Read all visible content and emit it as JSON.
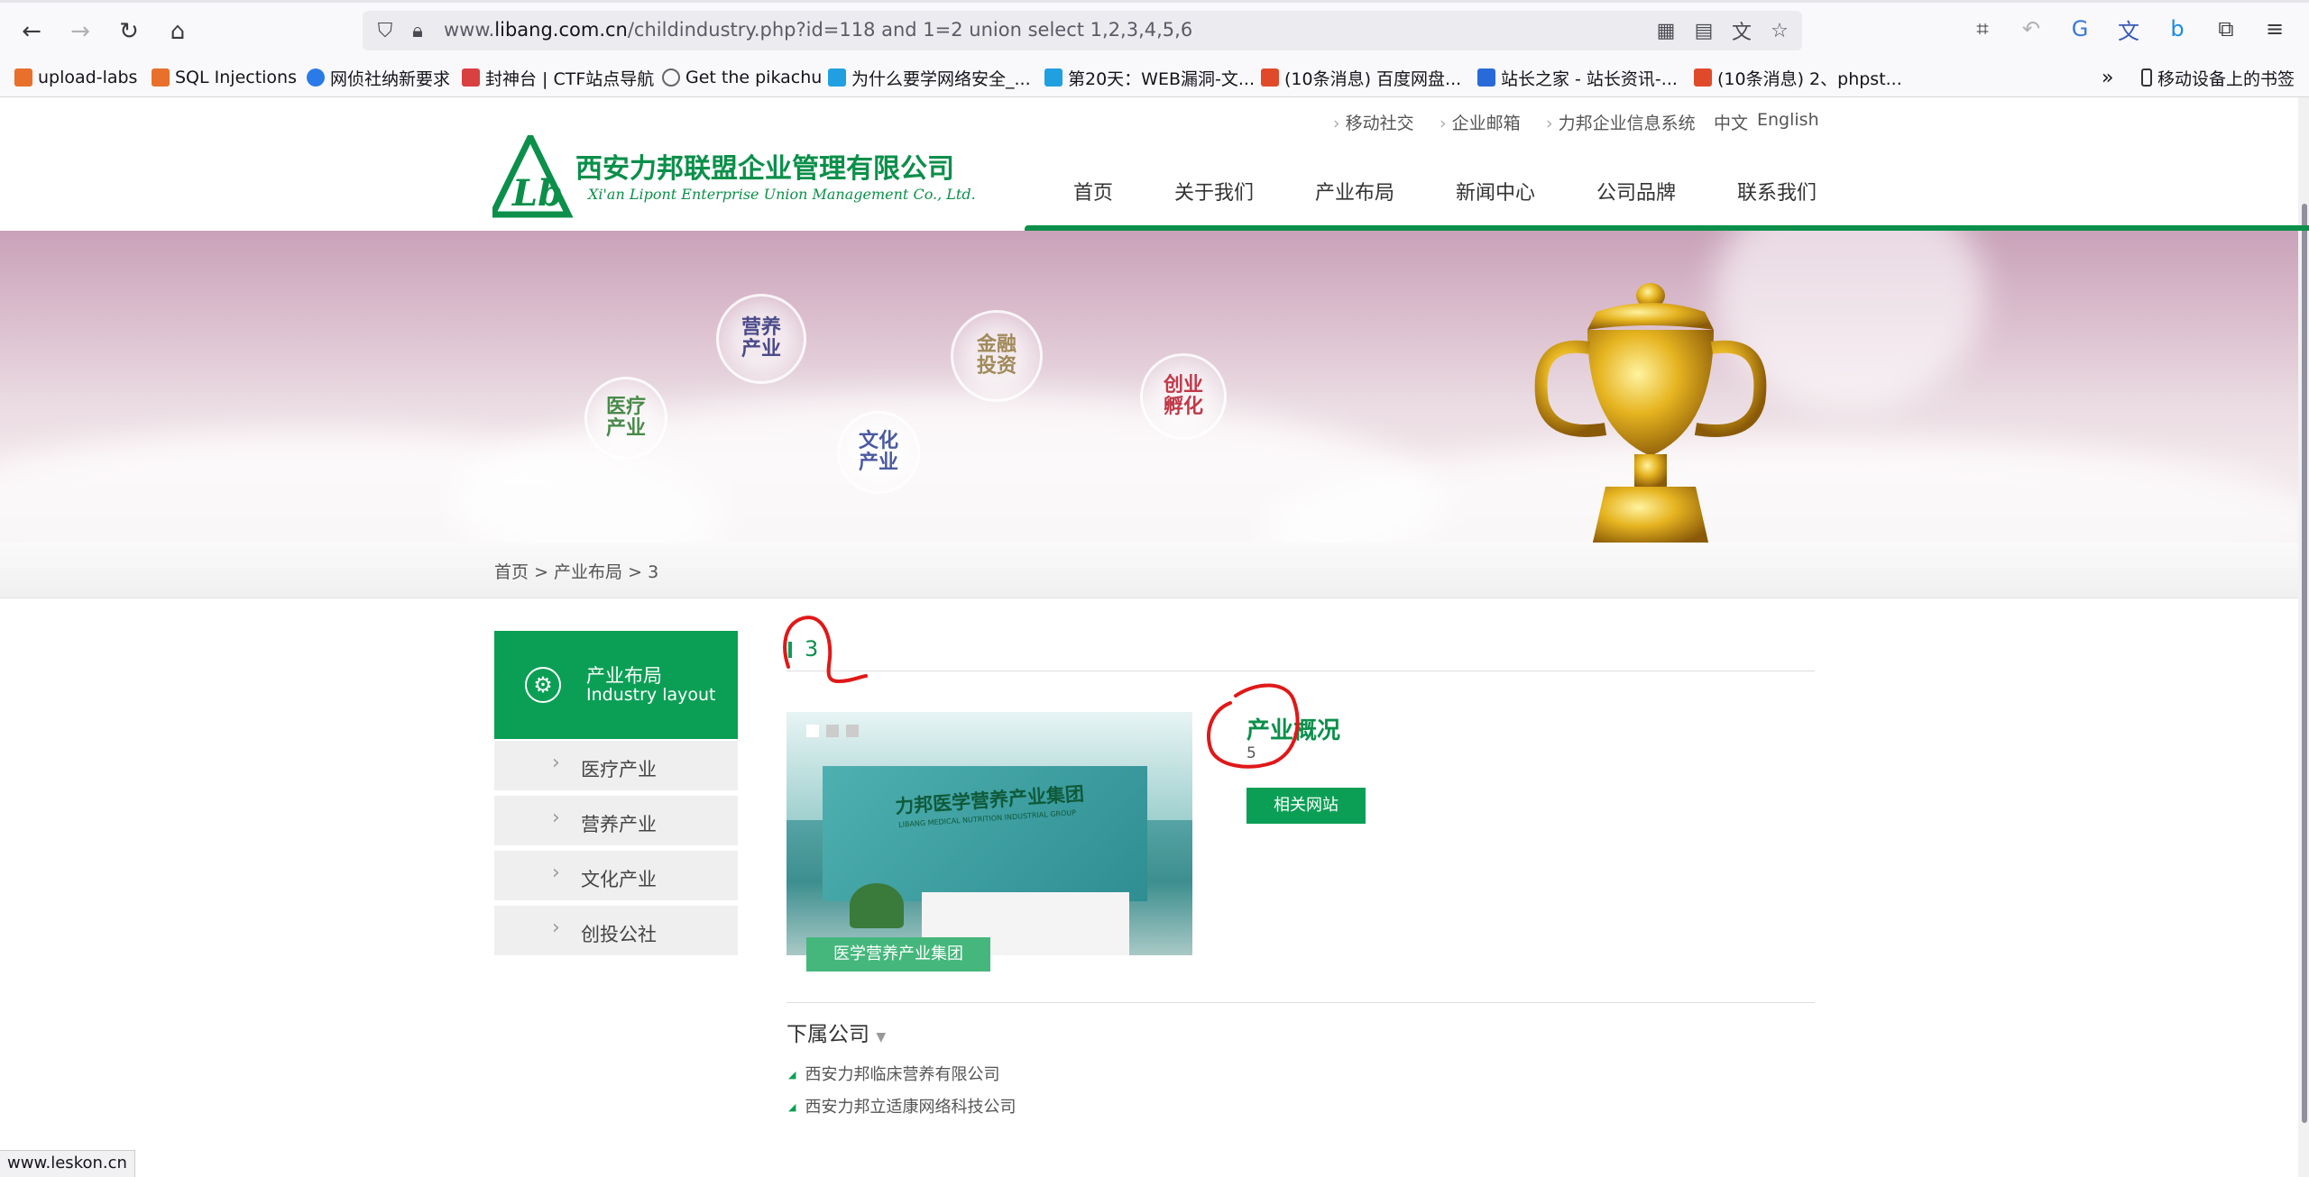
{
  "browser": {
    "url_prefix": "www.",
    "url_domain": "libang.com.cn",
    "url_path": "/childindustry.php?id=118 and 1=2 union select 1,2,3,4,5,6",
    "bookmarks": [
      {
        "label": "upload-labs",
        "color": "#e8702a"
      },
      {
        "label": "SQL Injections",
        "color": "#e8702a"
      },
      {
        "label": "网侦社纳新要求",
        "color": "#2a7be8"
      },
      {
        "label": "封神台 | CTF站点导航",
        "color": "#d94040"
      },
      {
        "label": "Get the pikachu",
        "color": "#666666"
      },
      {
        "label": "为什么要学网络安全_...",
        "color": "#20a0e0"
      },
      {
        "label": "第20天：WEB漏洞-文...",
        "color": "#20a0e0"
      },
      {
        "label": "(10条消息) 百度网盘...",
        "color": "#e04a2a"
      },
      {
        "label": "站长之家 - 站长资讯-...",
        "color": "#2a6ad8"
      },
      {
        "label": "(10条消息) 2、phpst...",
        "color": "#e04a2a"
      }
    ],
    "mobile_bookmarks": "移动设备上的书签",
    "status_url": "www.leskon.cn"
  },
  "site": {
    "logo_cn": "西安力邦联盟企业管理有限公司",
    "logo_en": "Xi'an Lipont Enterprise Union Management Co., Ltd.",
    "top_links": [
      "移动社交",
      "企业邮箱",
      "力邦企业信息系统"
    ],
    "lang_cn": "中文",
    "lang_en": "English",
    "nav": [
      "首页",
      "关于我们",
      "产业布局",
      "新闻中心",
      "公司品牌",
      "联系我们"
    ],
    "banner_bubbles": [
      {
        "text": "医疗\n产业",
        "color": "#4a8a4a"
      },
      {
        "text": "营养\n产业",
        "color": "#4a4a8a"
      },
      {
        "text": "文化\n产业",
        "color": "#4a5aa0"
      },
      {
        "text": "金融\n投资",
        "color": "#a08a5a"
      },
      {
        "text": "创业\n孵化",
        "color": "#c03a4a"
      }
    ],
    "breadcrumb": [
      "首页",
      "产业布局",
      "3"
    ],
    "sidebar": {
      "title_cn": "产业布局",
      "title_en": "Industry layout",
      "items": [
        "医疗产业",
        "营养产业",
        "文化产业",
        "创投公社"
      ]
    },
    "content": {
      "title": "3",
      "photo_caption": "医学营养产业集团",
      "photo_sign": "力邦医学营养产业集团",
      "photo_sign_en": "LIBANG MEDICAL NUTRITION INDUSTRIAL GROUP",
      "overview_title": "产业概况",
      "overview_value": "5",
      "related_button": "相关网站",
      "subsidiaries_title": "下属公司",
      "subsidiaries": [
        "西安力邦临床营养有限公司",
        "西安力邦立适康网络科技公司"
      ]
    }
  }
}
